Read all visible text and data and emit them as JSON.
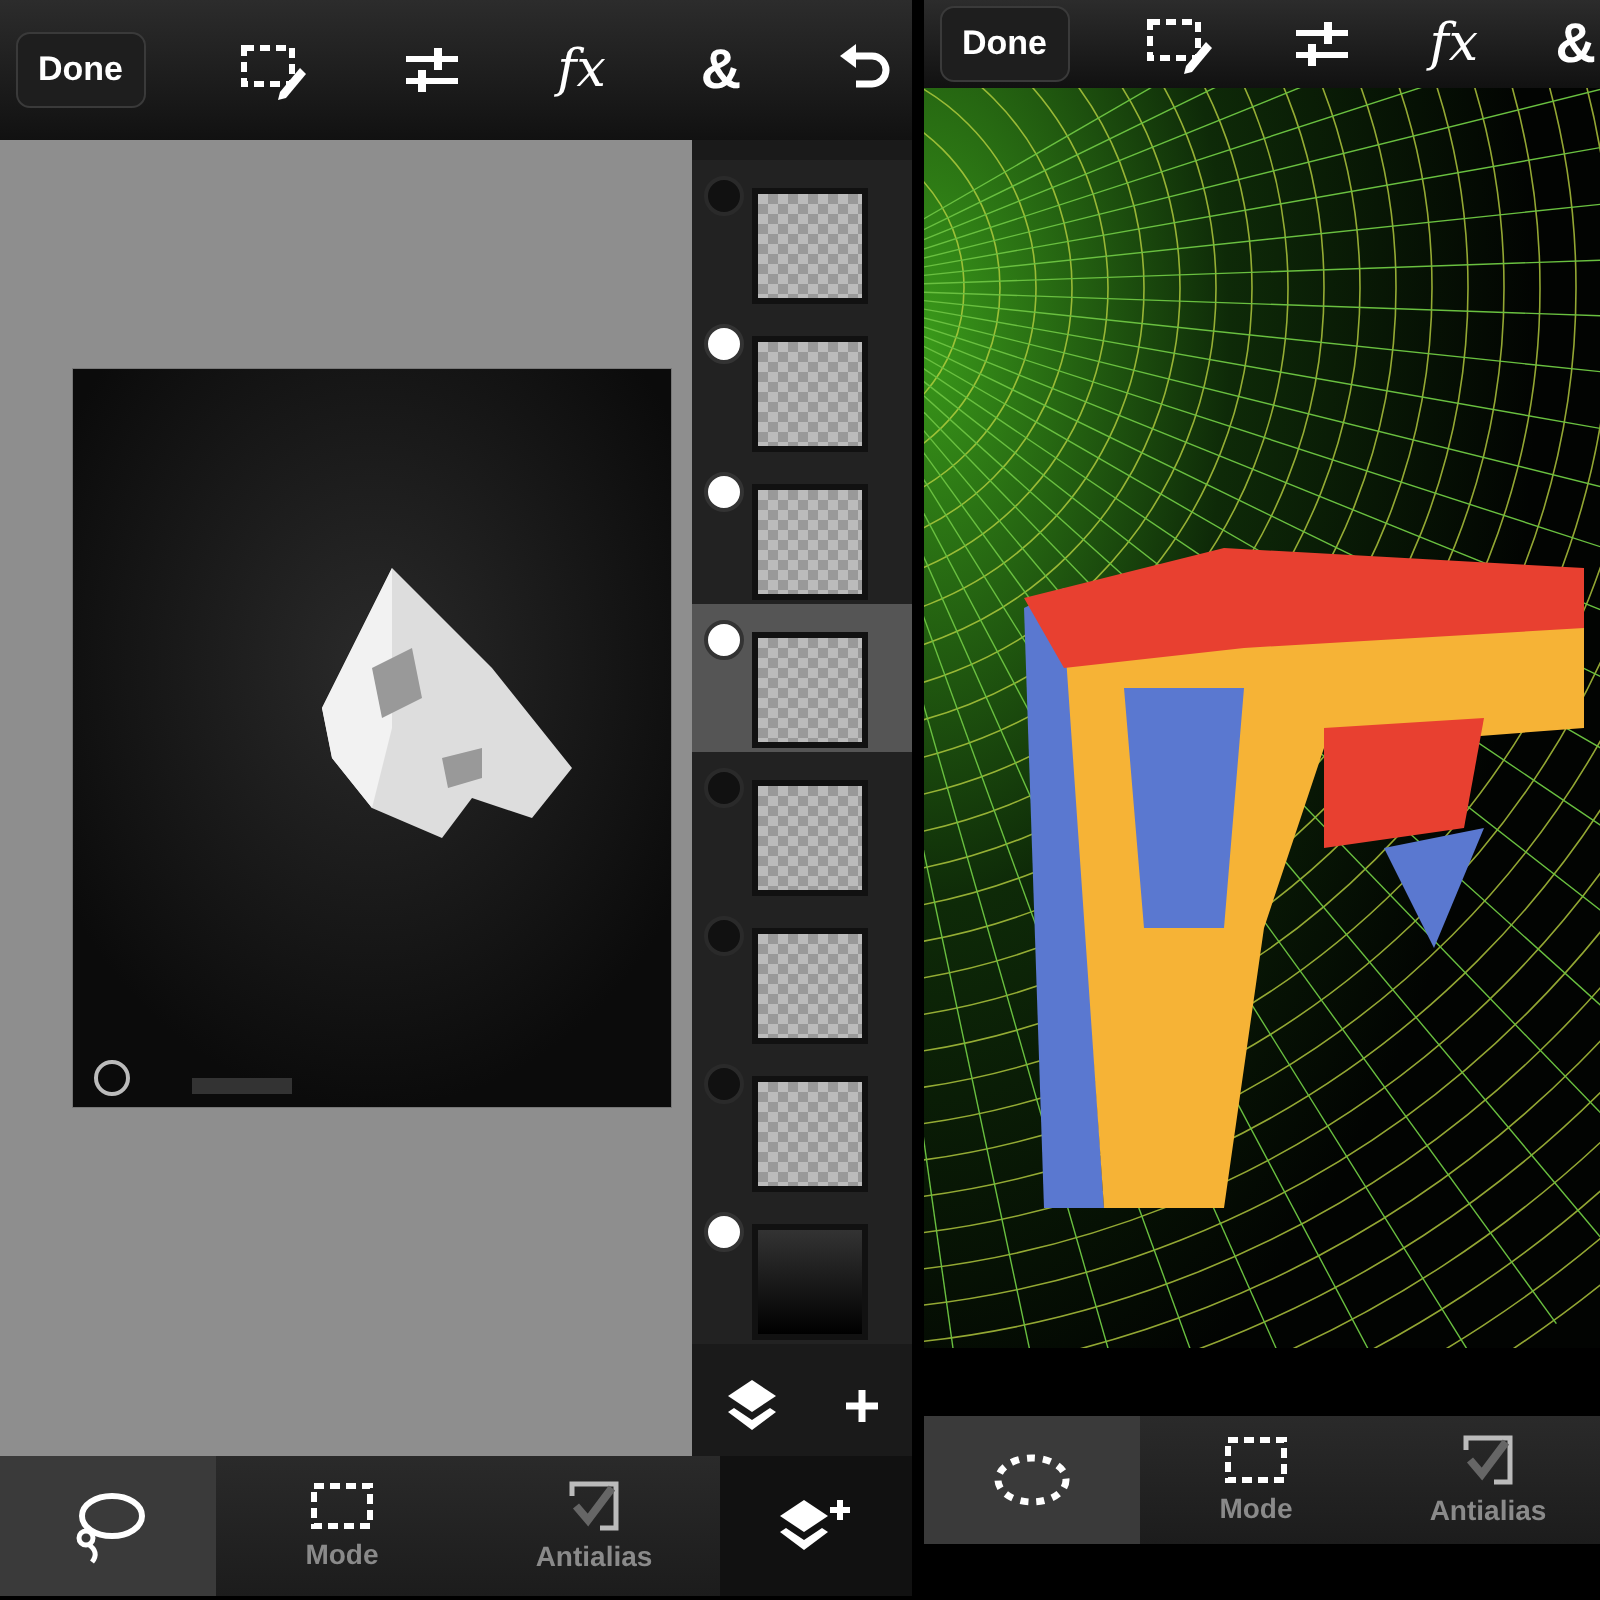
{
  "panels": [
    {
      "kind": "layers",
      "toolbar": {
        "done": "Done",
        "fx": "fx",
        "amp": "&",
        "undo": true
      },
      "layers": [
        {
          "visible": false,
          "selected": false
        },
        {
          "visible": true,
          "selected": false
        },
        {
          "visible": true,
          "selected": false
        },
        {
          "visible": true,
          "selected": true
        },
        {
          "visible": false,
          "selected": false
        },
        {
          "visible": false,
          "selected": false
        },
        {
          "visible": false,
          "selected": false
        },
        {
          "visible": true,
          "selected": false
        }
      ],
      "bottom_bar": [
        {
          "kind": "lasso",
          "selected": true
        },
        {
          "kind": "mode",
          "label": "Mode",
          "selected": false
        },
        {
          "kind": "antialias",
          "label": "Antialias",
          "checked": true
        }
      ]
    },
    {
      "kind": "canvas",
      "toolbar": {
        "done": "Done",
        "fx": "fx",
        "amp": "&",
        "undo": false
      },
      "bottom_bar": [
        {
          "kind": "ellipse",
          "selected": true
        },
        {
          "kind": "mode",
          "label": "Mode",
          "selected": false
        },
        {
          "kind": "antialias",
          "label": "Antialias",
          "checked": true
        }
      ]
    }
  ]
}
